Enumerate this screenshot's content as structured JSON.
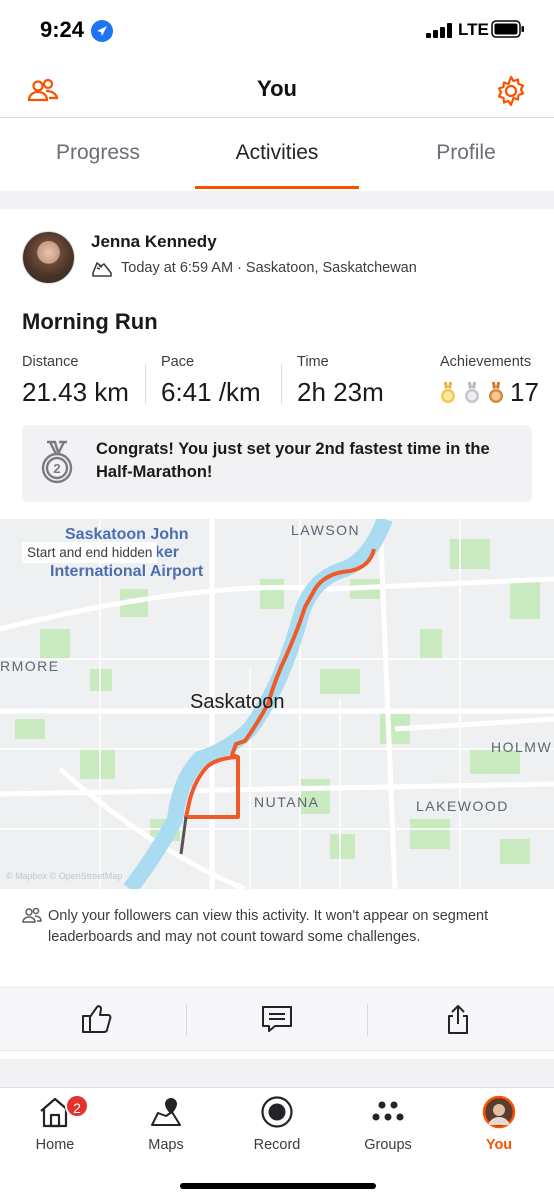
{
  "status": {
    "time": "9:24",
    "network": "LTE"
  },
  "header": {
    "title": "You"
  },
  "tabs": [
    {
      "label": "Progress"
    },
    {
      "label": "Activities"
    },
    {
      "label": "Profile"
    }
  ],
  "activity": {
    "athlete_name": "Jenna Kennedy",
    "meta": "Today at 6:59 AM · Saskatoon, Saskatchewan",
    "title": "Morning Run",
    "stats": {
      "distance_label": "Distance",
      "distance_value": "21.43 km",
      "pace_label": "Pace",
      "pace_value": "6:41 /km",
      "time_label": "Time",
      "time_value": "2h 23m",
      "achievements_label": "Achievements",
      "achievements_count": "17"
    },
    "congrats": "Congrats! You just set your 2nd fastest time in the Half-Marathon!",
    "medal_rank": "2",
    "privacy_note": "Only your followers can view this activity. It won't appear on segment leaderboards and may not count toward some challenges."
  },
  "map": {
    "hidden_notice": "Start and end hidden",
    "city": "Saskatoon",
    "airport_line1": "Saskatoon John",
    "airport_line2": "International Airport",
    "airport_fragment": "ker",
    "labels": [
      "LAWSON",
      "RMORE",
      "HOLMW",
      "NUTANA",
      "LAKEWOOD"
    ],
    "attribution": "© Mapbox © OpenStreetMap",
    "route_color": "#f05a28",
    "river_color": "#a9dbf1",
    "park_color": "#c9e9bf"
  },
  "nav": [
    {
      "label": "Home",
      "badge": "2"
    },
    {
      "label": "Maps"
    },
    {
      "label": "Record"
    },
    {
      "label": "Groups"
    },
    {
      "label": "You"
    }
  ],
  "colors": {
    "accent": "#fc5200",
    "text": "#242428",
    "muted": "#6d6d78"
  }
}
